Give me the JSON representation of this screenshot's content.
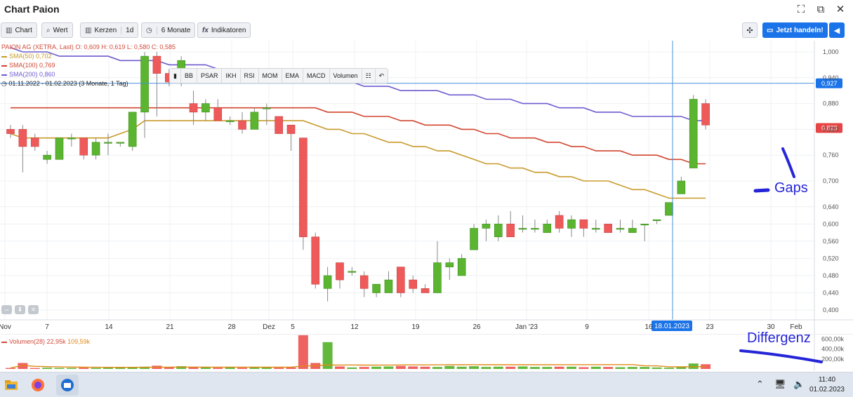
{
  "window": {
    "title": "Chart Paion"
  },
  "toolbar": {
    "chart_label": "Chart",
    "wert_label": "Wert",
    "kerzen_label": "Kerzen",
    "interval_label": "1d",
    "range_label": "6 Monate",
    "indikatoren_label": "Indikatoren",
    "trade_label": "Jetzt handeln!"
  },
  "legend": {
    "quote": "PAION AG (XETRA, Last)  O: 0,609  H: 0,619  L: 0,580  C: 0,585",
    "sma50": "SMA(50)  0,702",
    "sma100": "SMA(100)  0,769",
    "sma200": "SMA(200)  0,860",
    "period": "01.11.2022 - 01.02.2023   (3 Monate, 1 Tag)"
  },
  "indicator_bar": [
    "BB",
    "PSAR",
    "IKH",
    "RSI",
    "MOM",
    "EMA",
    "MACD",
    "Volumen"
  ],
  "volume_legend": {
    "label": "Volumen(28)",
    "value": "22,95k",
    "avg": "109,59k"
  },
  "annotations": {
    "gaps": "Gaps",
    "divergence": "Differgenz"
  },
  "price_markers": {
    "crosshair_price": "0,927",
    "last_price": "0,823",
    "crosshair_date": "18.01.2023"
  },
  "colors": {
    "up": "#5bb530",
    "down": "#ee5a5a",
    "sma50": "#c89a2a",
    "sma100": "#d2442e",
    "sma200": "#6f5ad0",
    "crosshair": "#4a90d9",
    "accent": "#1a73e8",
    "annotation": "#2525d8"
  },
  "taskbar": {
    "time": "11:40",
    "date": "01.02.2023"
  },
  "chart_data": {
    "type": "candlestick",
    "y_ticks": [
      "1,000",
      "0,940",
      "0,880",
      "0,820",
      "0,760",
      "0,700",
      "0,640",
      "0,600",
      "0,560",
      "0,520",
      "0,480",
      "0,440",
      "0,400"
    ],
    "ylim": [
      0.39,
      1.01
    ],
    "x_ticks": [
      "Nov",
      "7",
      "14",
      "21",
      "28",
      "Dez",
      "5",
      "12",
      "19",
      "26",
      "Jan '23",
      "9",
      "16",
      "23",
      "30",
      "Feb"
    ],
    "candles": [
      [
        0.82,
        0.81,
        0.83,
        0.8
      ],
      [
        0.82,
        0.78,
        0.83,
        0.72
      ],
      [
        0.8,
        0.78,
        0.81,
        0.77
      ],
      [
        0.75,
        0.76,
        0.77,
        0.74
      ],
      [
        0.75,
        0.8,
        0.8,
        0.75
      ],
      [
        0.8,
        0.8,
        0.81,
        0.78
      ],
      [
        0.8,
        0.76,
        0.8,
        0.75
      ],
      [
        0.76,
        0.79,
        0.8,
        0.75
      ],
      [
        0.79,
        0.79,
        0.81,
        0.76
      ],
      [
        0.79,
        0.79,
        0.79,
        0.78
      ],
      [
        0.78,
        0.86,
        0.86,
        0.77
      ],
      [
        0.86,
        0.99,
        1.0,
        0.8
      ],
      [
        0.99,
        0.95,
        1.0,
        0.85
      ],
      [
        0.95,
        0.93,
        0.96,
        0.92
      ],
      [
        0.93,
        0.98,
        0.99,
        0.92
      ],
      [
        0.88,
        0.86,
        0.91,
        0.83
      ],
      [
        0.86,
        0.88,
        0.89,
        0.84
      ],
      [
        0.87,
        0.84,
        0.89,
        0.84
      ],
      [
        0.84,
        0.84,
        0.85,
        0.83
      ],
      [
        0.84,
        0.82,
        0.86,
        0.81
      ],
      [
        0.82,
        0.86,
        0.87,
        0.82
      ],
      [
        0.87,
        0.87,
        0.88,
        0.83
      ],
      [
        0.85,
        0.81,
        0.85,
        0.81
      ],
      [
        0.83,
        0.81,
        0.83,
        0.77
      ],
      [
        0.8,
        0.57,
        0.8,
        0.54
      ],
      [
        0.57,
        0.46,
        0.58,
        0.45
      ],
      [
        0.45,
        0.48,
        0.5,
        0.42
      ],
      [
        0.51,
        0.47,
        0.51,
        0.45
      ],
      [
        0.49,
        0.49,
        0.5,
        0.48
      ],
      [
        0.48,
        0.45,
        0.49,
        0.43
      ],
      [
        0.44,
        0.46,
        0.46,
        0.43
      ],
      [
        0.44,
        0.47,
        0.49,
        0.44
      ],
      [
        0.5,
        0.44,
        0.5,
        0.43
      ],
      [
        0.47,
        0.45,
        0.48,
        0.44
      ],
      [
        0.45,
        0.44,
        0.46,
        0.44
      ],
      [
        0.44,
        0.51,
        0.56,
        0.44
      ],
      [
        0.5,
        0.51,
        0.52,
        0.47
      ],
      [
        0.48,
        0.52,
        0.53,
        0.48
      ],
      [
        0.54,
        0.59,
        0.6,
        0.54
      ],
      [
        0.59,
        0.6,
        0.61,
        0.56
      ],
      [
        0.57,
        0.6,
        0.62,
        0.56
      ],
      [
        0.6,
        0.57,
        0.63,
        0.57
      ],
      [
        0.59,
        0.59,
        0.62,
        0.58
      ],
      [
        0.59,
        0.59,
        0.61,
        0.58
      ],
      [
        0.58,
        0.6,
        0.61,
        0.58
      ],
      [
        0.62,
        0.59,
        0.63,
        0.58
      ],
      [
        0.59,
        0.61,
        0.62,
        0.57
      ],
      [
        0.61,
        0.59,
        0.61,
        0.57
      ],
      [
        0.59,
        0.59,
        0.61,
        0.58
      ],
      [
        0.6,
        0.58,
        0.6,
        0.58
      ],
      [
        0.59,
        0.59,
        0.61,
        0.58
      ],
      [
        0.58,
        0.59,
        0.61,
        0.58
      ],
      [
        0.6,
        0.6,
        0.6,
        0.56
      ],
      [
        0.61,
        0.61,
        0.61,
        0.6
      ],
      [
        0.62,
        0.65,
        0.65,
        0.62
      ],
      [
        0.67,
        0.7,
        0.71,
        0.67
      ],
      [
        0.73,
        0.89,
        0.9,
        0.73
      ],
      [
        0.88,
        0.83,
        0.89,
        0.82
      ]
    ],
    "sma50": [
      0.81,
      0.8,
      0.8,
      0.8,
      0.8,
      0.8,
      0.8,
      0.8,
      0.8,
      0.81,
      0.82,
      0.84,
      0.84,
      0.84,
      0.84,
      0.84,
      0.84,
      0.84,
      0.84,
      0.84,
      0.84,
      0.84,
      0.84,
      0.84,
      0.84,
      0.83,
      0.82,
      0.82,
      0.81,
      0.81,
      0.8,
      0.79,
      0.79,
      0.78,
      0.78,
      0.77,
      0.77,
      0.76,
      0.75,
      0.74,
      0.74,
      0.73,
      0.73,
      0.72,
      0.72,
      0.71,
      0.71,
      0.7,
      0.7,
      0.7,
      0.69,
      0.68,
      0.68,
      0.67,
      0.66,
      0.66,
      0.66,
      0.66
    ],
    "sma100": [
      0.87,
      0.87,
      0.87,
      0.87,
      0.87,
      0.87,
      0.87,
      0.87,
      0.87,
      0.87,
      0.87,
      0.87,
      0.87,
      0.87,
      0.87,
      0.87,
      0.87,
      0.87,
      0.87,
      0.87,
      0.87,
      0.87,
      0.87,
      0.87,
      0.87,
      0.87,
      0.86,
      0.86,
      0.86,
      0.85,
      0.85,
      0.85,
      0.84,
      0.84,
      0.83,
      0.83,
      0.83,
      0.82,
      0.82,
      0.81,
      0.81,
      0.8,
      0.8,
      0.8,
      0.79,
      0.79,
      0.78,
      0.78,
      0.77,
      0.77,
      0.77,
      0.76,
      0.76,
      0.76,
      0.75,
      0.75,
      0.74,
      0.74
    ],
    "sma200": [
      1.01,
      1.0,
      1.0,
      1.0,
      0.99,
      0.99,
      0.99,
      0.99,
      0.99,
      0.98,
      0.98,
      0.98,
      0.98,
      0.97,
      0.97,
      0.97,
      0.97,
      0.96,
      0.96,
      0.96,
      0.96,
      0.95,
      0.95,
      0.95,
      0.95,
      0.94,
      0.94,
      0.93,
      0.93,
      0.92,
      0.92,
      0.92,
      0.91,
      0.91,
      0.91,
      0.91,
      0.9,
      0.9,
      0.9,
      0.89,
      0.89,
      0.89,
      0.88,
      0.88,
      0.88,
      0.87,
      0.87,
      0.87,
      0.86,
      0.86,
      0.86,
      0.85,
      0.85,
      0.85,
      0.85,
      0.85,
      0.84,
      0.84
    ],
    "volume_ticks": [
      "600,00k",
      "400,00k",
      "200,00k"
    ],
    "volume_max": 650,
    "volumes": [
      20,
      120,
      20,
      25,
      20,
      20,
      25,
      20,
      25,
      25,
      40,
      45,
      65,
      40,
      55,
      40,
      30,
      25,
      40,
      25,
      30,
      35,
      25,
      30,
      680,
      120,
      540,
      50,
      30,
      40,
      45,
      50,
      60,
      50,
      45,
      40,
      60,
      45,
      55,
      40,
      45,
      45,
      50,
      40,
      40,
      45,
      45,
      35,
      45,
      40,
      35,
      40,
      40,
      30,
      25,
      40,
      110,
      95
    ]
  }
}
